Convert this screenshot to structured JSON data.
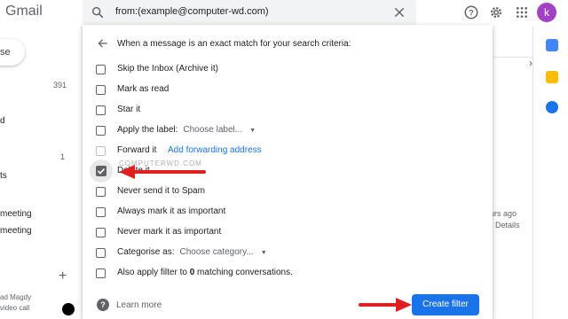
{
  "app": {
    "title": "Gmail"
  },
  "search": {
    "query": "from:(example@computer-wd.com)"
  },
  "account": {
    "avatar_letter": "k",
    "avatar_color": "#a142c6"
  },
  "sidebar": {
    "compose_label": "se",
    "fragments": [
      "d",
      "ts",
      "meeting",
      "meeting"
    ],
    "counts": [
      "391",
      "1"
    ],
    "bottom_name": "ad Magdy",
    "bottom_sub": "video call"
  },
  "background": {
    "time_text": "urs ago",
    "details_text": "Details"
  },
  "filter": {
    "heading": "When a message is an exact match for your search criteria:",
    "options": [
      {
        "label": "Skip the Inbox (Archive it)",
        "checked": false
      },
      {
        "label": "Mark as read",
        "checked": false
      },
      {
        "label": "Star it",
        "checked": false
      },
      {
        "label": "Apply the label:",
        "dropdown": "Choose label...",
        "checked": false
      },
      {
        "label": "Forward it",
        "link": "Add forwarding address",
        "checked": false
      },
      {
        "label": "Delete it",
        "checked": true
      },
      {
        "label": "Never send it to Spam",
        "checked": false
      },
      {
        "label": "Always mark it as important",
        "checked": false
      },
      {
        "label": "Never mark it as important",
        "checked": false
      },
      {
        "label": "Categorise as:",
        "dropdown": "Choose category...",
        "checked": false
      },
      {
        "label_prefix": "Also apply filter to ",
        "label_count": "0",
        "label_suffix": " matching conversations.",
        "checked": false
      }
    ],
    "learn_more": "Learn more",
    "create_button": "Create filter"
  },
  "watermark": "COMPUTERWD.COM",
  "colors": {
    "accent": "#1a73e8",
    "annotation_arrow": "#e02020"
  }
}
